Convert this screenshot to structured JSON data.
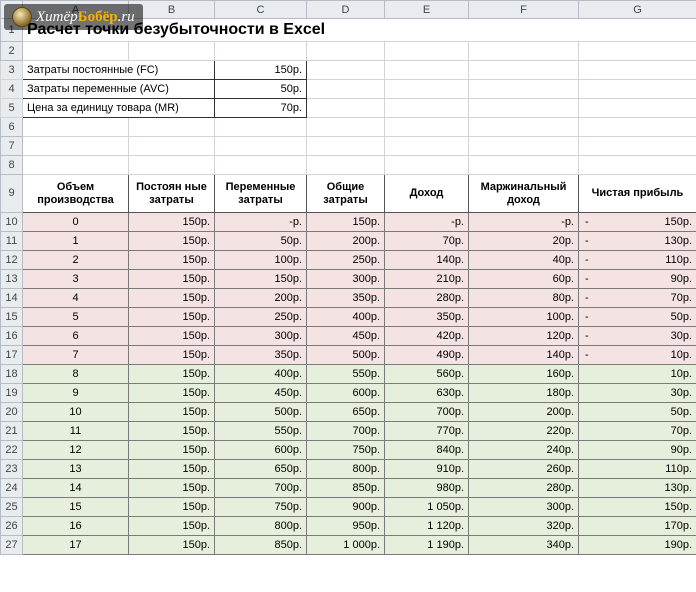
{
  "watermark": {
    "text_prefix": "Хитёр",
    "text_accent": "Бобёр",
    "text_suffix": ".ru"
  },
  "title": "Расчет точки безубыточности в Excel",
  "col_headers": [
    "A",
    "B",
    "C",
    "D",
    "E",
    "F",
    "G"
  ],
  "params": [
    {
      "row": "3",
      "label": "Затраты постоянные (FC)",
      "value": "150р."
    },
    {
      "row": "4",
      "label": "Затраты переменные (AVC)",
      "value": "50р."
    },
    {
      "row": "5",
      "label": "Цена за единицу товара (MR)",
      "value": "70р."
    }
  ],
  "table_headers": {
    "row": "9",
    "cols": [
      "Объем производства",
      "Постоян ные затраты",
      "Переменные затраты",
      "Общие затраты",
      "Доход",
      "Маржинальный доход",
      "Чистая прибыль"
    ]
  },
  "rows": [
    {
      "row": "10",
      "q": "0",
      "fc": "150р.",
      "vc": "-р.",
      "tc": "150р.",
      "rev": "-р.",
      "md": "-р.",
      "np": "150р.",
      "np_neg": true,
      "cls": "loss"
    },
    {
      "row": "11",
      "q": "1",
      "fc": "150р.",
      "vc": "50р.",
      "tc": "200р.",
      "rev": "70р.",
      "md": "20р.",
      "np": "130р.",
      "np_neg": true,
      "cls": "loss"
    },
    {
      "row": "12",
      "q": "2",
      "fc": "150р.",
      "vc": "100р.",
      "tc": "250р.",
      "rev": "140р.",
      "md": "40р.",
      "np": "110р.",
      "np_neg": true,
      "cls": "loss"
    },
    {
      "row": "13",
      "q": "3",
      "fc": "150р.",
      "vc": "150р.",
      "tc": "300р.",
      "rev": "210р.",
      "md": "60р.",
      "np": "90р.",
      "np_neg": true,
      "cls": "loss"
    },
    {
      "row": "14",
      "q": "4",
      "fc": "150р.",
      "vc": "200р.",
      "tc": "350р.",
      "rev": "280р.",
      "md": "80р.",
      "np": "70р.",
      "np_neg": true,
      "cls": "loss"
    },
    {
      "row": "15",
      "q": "5",
      "fc": "150р.",
      "vc": "250р.",
      "tc": "400р.",
      "rev": "350р.",
      "md": "100р.",
      "np": "50р.",
      "np_neg": true,
      "cls": "loss"
    },
    {
      "row": "16",
      "q": "6",
      "fc": "150р.",
      "vc": "300р.",
      "tc": "450р.",
      "rev": "420р.",
      "md": "120р.",
      "np": "30р.",
      "np_neg": true,
      "cls": "loss"
    },
    {
      "row": "17",
      "q": "7",
      "fc": "150р.",
      "vc": "350р.",
      "tc": "500р.",
      "rev": "490р.",
      "md": "140р.",
      "np": "10р.",
      "np_neg": true,
      "cls": "loss"
    },
    {
      "row": "18",
      "q": "8",
      "fc": "150р.",
      "vc": "400р.",
      "tc": "550р.",
      "rev": "560р.",
      "md": "160р.",
      "np": "10р.",
      "np_neg": false,
      "cls": "gain"
    },
    {
      "row": "19",
      "q": "9",
      "fc": "150р.",
      "vc": "450р.",
      "tc": "600р.",
      "rev": "630р.",
      "md": "180р.",
      "np": "30р.",
      "np_neg": false,
      "cls": "gain"
    },
    {
      "row": "20",
      "q": "10",
      "fc": "150р.",
      "vc": "500р.",
      "tc": "650р.",
      "rev": "700р.",
      "md": "200р.",
      "np": "50р.",
      "np_neg": false,
      "cls": "gain"
    },
    {
      "row": "21",
      "q": "11",
      "fc": "150р.",
      "vc": "550р.",
      "tc": "700р.",
      "rev": "770р.",
      "md": "220р.",
      "np": "70р.",
      "np_neg": false,
      "cls": "gain"
    },
    {
      "row": "22",
      "q": "12",
      "fc": "150р.",
      "vc": "600р.",
      "tc": "750р.",
      "rev": "840р.",
      "md": "240р.",
      "np": "90р.",
      "np_neg": false,
      "cls": "gain"
    },
    {
      "row": "23",
      "q": "13",
      "fc": "150р.",
      "vc": "650р.",
      "tc": "800р.",
      "rev": "910р.",
      "md": "260р.",
      "np": "110р.",
      "np_neg": false,
      "cls": "gain"
    },
    {
      "row": "24",
      "q": "14",
      "fc": "150р.",
      "vc": "700р.",
      "tc": "850р.",
      "rev": "980р.",
      "md": "280р.",
      "np": "130р.",
      "np_neg": false,
      "cls": "gain"
    },
    {
      "row": "25",
      "q": "15",
      "fc": "150р.",
      "vc": "750р.",
      "tc": "900р.",
      "rev": "1 050р.",
      "md": "300р.",
      "np": "150р.",
      "np_neg": false,
      "cls": "gain"
    },
    {
      "row": "26",
      "q": "16",
      "fc": "150р.",
      "vc": "800р.",
      "tc": "950р.",
      "rev": "1 120р.",
      "md": "320р.",
      "np": "170р.",
      "np_neg": false,
      "cls": "gain"
    },
    {
      "row": "27",
      "q": "17",
      "fc": "150р.",
      "vc": "850р.",
      "tc": "1 000р.",
      "rev": "1 190р.",
      "md": "340р.",
      "np": "190р.",
      "np_neg": false,
      "cls": "gain"
    }
  ],
  "chart_data": {
    "type": "table",
    "title": "Расчет точки безубыточности в Excel",
    "fixed_cost": 150,
    "variable_cost_per_unit": 50,
    "price_per_unit": 70,
    "currency": "р.",
    "columns": [
      "Объем производства",
      "Постоянные затраты",
      "Переменные затраты",
      "Общие затраты",
      "Доход",
      "Маржинальный доход",
      "Чистая прибыль"
    ],
    "data": [
      {
        "q": 0,
        "fc": 150,
        "vc": 0,
        "tc": 150,
        "rev": 0,
        "md": 0,
        "np": -150
      },
      {
        "q": 1,
        "fc": 150,
        "vc": 50,
        "tc": 200,
        "rev": 70,
        "md": 20,
        "np": -130
      },
      {
        "q": 2,
        "fc": 150,
        "vc": 100,
        "tc": 250,
        "rev": 140,
        "md": 40,
        "np": -110
      },
      {
        "q": 3,
        "fc": 150,
        "vc": 150,
        "tc": 300,
        "rev": 210,
        "md": 60,
        "np": -90
      },
      {
        "q": 4,
        "fc": 150,
        "vc": 200,
        "tc": 350,
        "rev": 280,
        "md": 80,
        "np": -70
      },
      {
        "q": 5,
        "fc": 150,
        "vc": 250,
        "tc": 400,
        "rev": 350,
        "md": 100,
        "np": -50
      },
      {
        "q": 6,
        "fc": 150,
        "vc": 300,
        "tc": 450,
        "rev": 420,
        "md": 120,
        "np": -30
      },
      {
        "q": 7,
        "fc": 150,
        "vc": 350,
        "tc": 500,
        "rev": 490,
        "md": 140,
        "np": -10
      },
      {
        "q": 8,
        "fc": 150,
        "vc": 400,
        "tc": 550,
        "rev": 560,
        "md": 160,
        "np": 10
      },
      {
        "q": 9,
        "fc": 150,
        "vc": 450,
        "tc": 600,
        "rev": 630,
        "md": 180,
        "np": 30
      },
      {
        "q": 10,
        "fc": 150,
        "vc": 500,
        "tc": 650,
        "rev": 700,
        "md": 200,
        "np": 50
      },
      {
        "q": 11,
        "fc": 150,
        "vc": 550,
        "tc": 700,
        "rev": 770,
        "md": 220,
        "np": 70
      },
      {
        "q": 12,
        "fc": 150,
        "vc": 600,
        "tc": 750,
        "rev": 840,
        "md": 240,
        "np": 90
      },
      {
        "q": 13,
        "fc": 150,
        "vc": 650,
        "tc": 800,
        "rev": 910,
        "md": 260,
        "np": 110
      },
      {
        "q": 14,
        "fc": 150,
        "vc": 700,
        "tc": 850,
        "rev": 980,
        "md": 280,
        "np": 130
      },
      {
        "q": 15,
        "fc": 150,
        "vc": 750,
        "tc": 900,
        "rev": 1050,
        "md": 300,
        "np": 150
      },
      {
        "q": 16,
        "fc": 150,
        "vc": 800,
        "tc": 950,
        "rev": 1120,
        "md": 320,
        "np": 170
      },
      {
        "q": 17,
        "fc": 150,
        "vc": 850,
        "tc": 1000,
        "rev": 1190,
        "md": 340,
        "np": 190
      }
    ]
  }
}
